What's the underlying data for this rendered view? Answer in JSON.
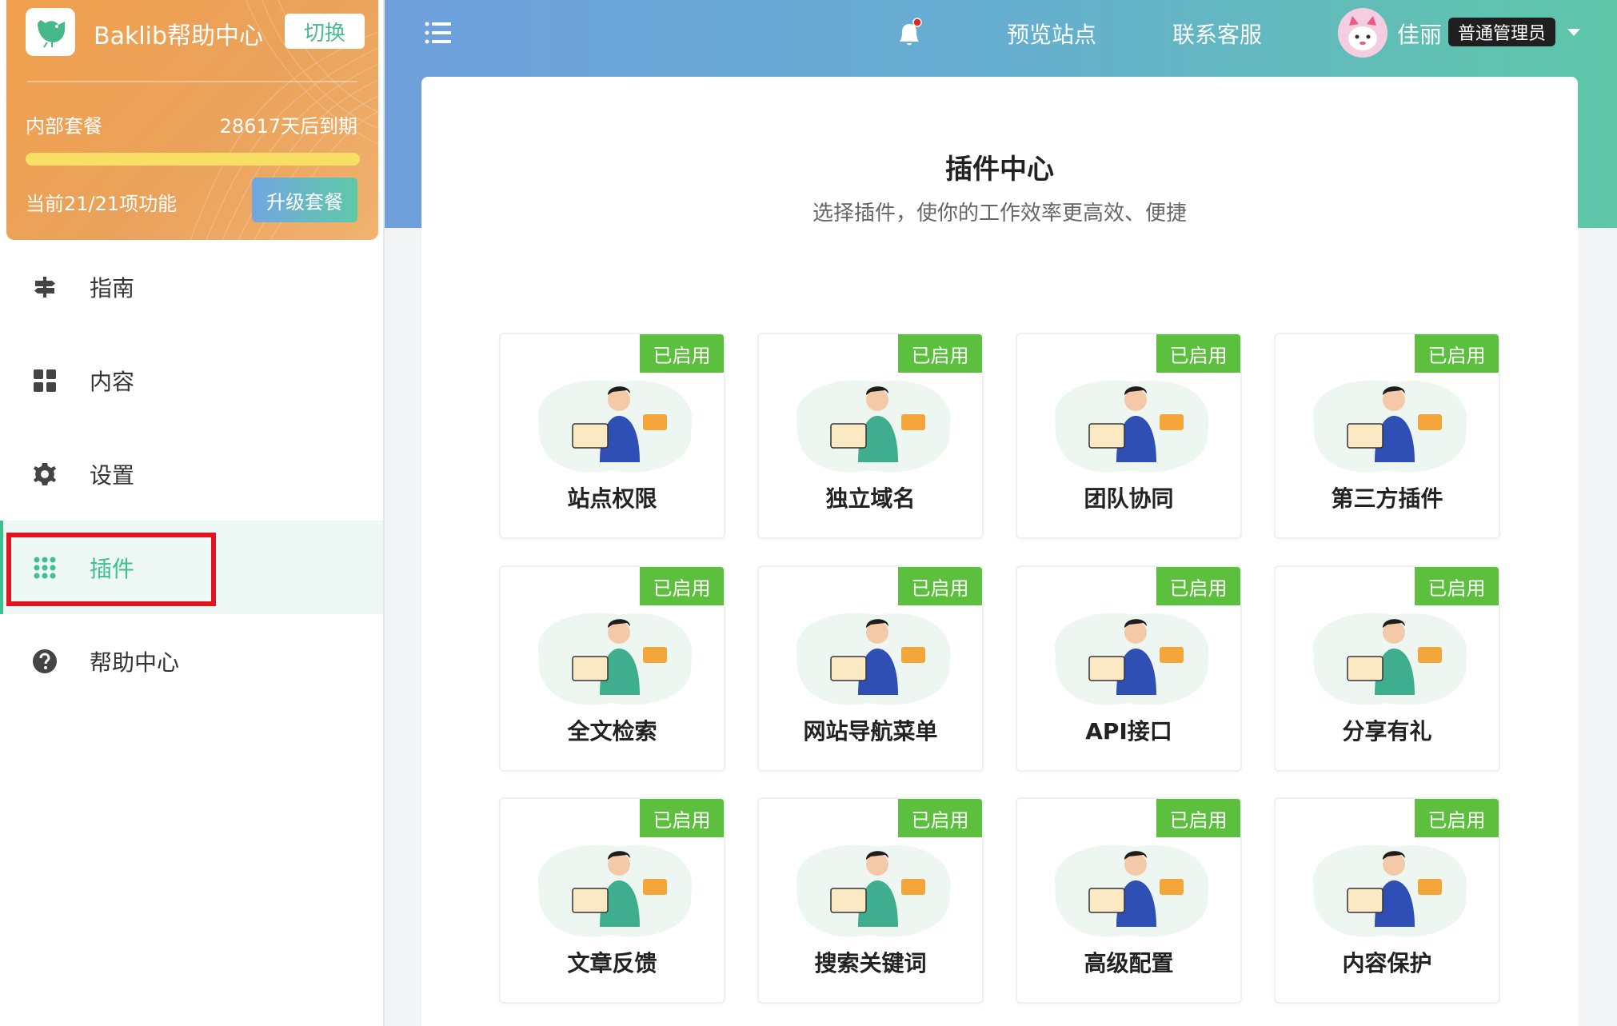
{
  "brand": {
    "name": "Baklib帮助中心",
    "switch_label": "切换"
  },
  "plan": {
    "name": "内部套餐",
    "expire": "28617天后到期",
    "progress": 1.0,
    "features": "当前21/21项功能",
    "upgrade_label": "升级套餐"
  },
  "sidebar": {
    "items": [
      {
        "label": "指南",
        "icon": "signpost-icon",
        "active": false
      },
      {
        "label": "内容",
        "icon": "grid-icon",
        "active": false
      },
      {
        "label": "设置",
        "icon": "gear-icon",
        "active": false
      },
      {
        "label": "插件",
        "icon": "dots-grid-icon",
        "active": true
      },
      {
        "label": "帮助中心",
        "icon": "question-circle-icon",
        "active": false
      }
    ]
  },
  "header": {
    "preview_label": "预览站点",
    "support_label": "联系客服",
    "user_name": "佳丽",
    "role": "普通管理员"
  },
  "main": {
    "title": "插件中心",
    "subtitle": "选择插件，使你的工作效率更高效、便捷",
    "badge_label": "已启用",
    "plugins": [
      {
        "label": "站点权限"
      },
      {
        "label": "独立域名"
      },
      {
        "label": "团队协同"
      },
      {
        "label": "第三方插件"
      },
      {
        "label": "全文检索"
      },
      {
        "label": "网站导航菜单"
      },
      {
        "label": "API接口"
      },
      {
        "label": "分享有礼"
      },
      {
        "label": "文章反馈"
      },
      {
        "label": "搜索关键词"
      },
      {
        "label": "高级配置"
      },
      {
        "label": "内容保护"
      }
    ]
  },
  "colors": {
    "accent": "#3fbf8c",
    "badge": "#5cbf3d",
    "plan_orange": "#f0a04d",
    "highlight": "#e0131e"
  }
}
